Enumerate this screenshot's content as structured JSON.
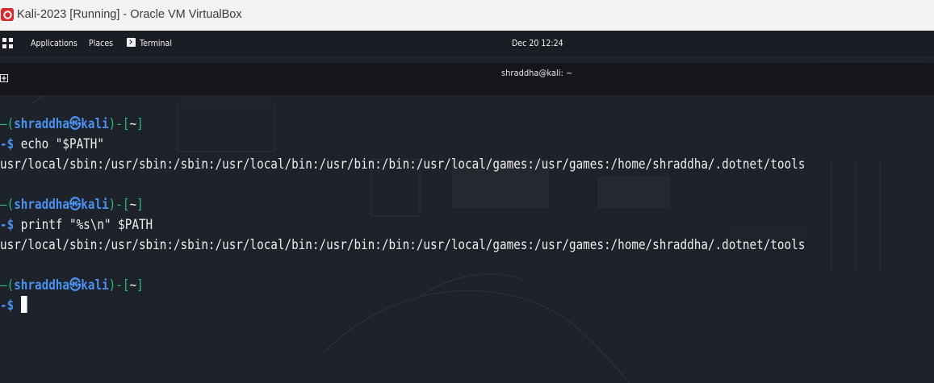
{
  "window": {
    "title": "Kali-2023 [Running] - Oracle VM VirtualBox"
  },
  "panel": {
    "applications": "Applications",
    "places": "Places",
    "terminal": "Terminal",
    "clock": "Dec 20  12:24"
  },
  "terminal": {
    "title": "shraddha@kali: ~",
    "prompt": {
      "open": "—(",
      "user": "shraddha",
      "symbol": "㉿",
      "host": "kali",
      "close": ")-[",
      "dir": "~",
      "end": "]",
      "dollar": "-$ "
    },
    "entries": [
      {
        "command": "echo \"$PATH\"",
        "output": "usr/local/sbin:/usr/sbin:/sbin:/usr/local/bin:/usr/bin:/bin:/usr/local/games:/usr/games:/home/shraddha/.dotnet/tools"
      },
      {
        "command": "printf \"%s\\n\" $PATH",
        "output": "usr/local/sbin:/usr/sbin:/sbin:/usr/local/bin:/usr/bin:/bin:/usr/local/games:/usr/games:/home/shraddha/.dotnet/tools"
      }
    ]
  },
  "icons": [
    "virtualbox-icon",
    "app-grid-icon",
    "terminal-icon",
    "new-tab-icon"
  ],
  "colors": {
    "prompt_green": "#2fb87f",
    "prompt_blue": "#4a91f0",
    "panel_bg": "#1a1d23",
    "terminal_bg": "#1e222a"
  }
}
